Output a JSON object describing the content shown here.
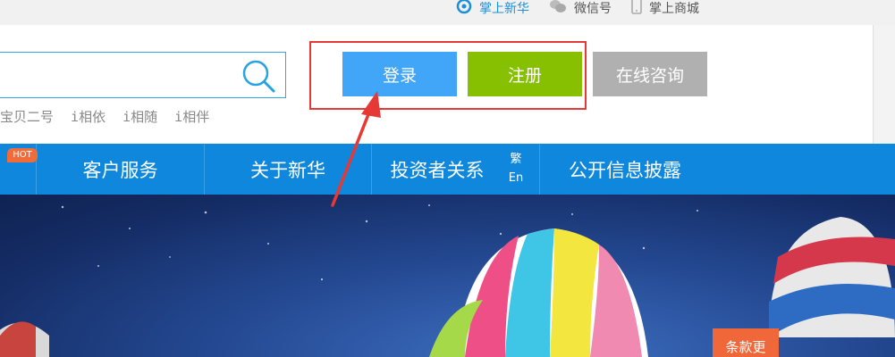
{
  "topbar": {
    "links": [
      {
        "label": "掌上新华",
        "icon": "mobile-app-icon"
      },
      {
        "label": "微信号",
        "icon": "wechat-icon"
      },
      {
        "label": "掌上商城",
        "icon": "phone-icon"
      }
    ]
  },
  "search": {
    "hot_words": [
      "宝贝二号",
      "i相依",
      "i相随",
      "i相伴"
    ]
  },
  "header": {
    "login_label": "登录",
    "register_label": "注册",
    "consult_label": "在线咨询"
  },
  "nav": {
    "hot_badge": "HOT",
    "items": [
      "客户服务",
      "关于新华",
      "投资者关系",
      "公开信息披露"
    ],
    "lang_traditional": "繁",
    "lang_english": "En"
  },
  "banner": {
    "promo_tab": "条款更"
  },
  "colors": {
    "nav_blue": "#0e87dd",
    "login_blue": "#41a5f8",
    "register_green": "#86c000",
    "consult_gray": "#b0b0b0",
    "annotation_red": "#e53935",
    "hot_orange": "#f26b3a"
  }
}
